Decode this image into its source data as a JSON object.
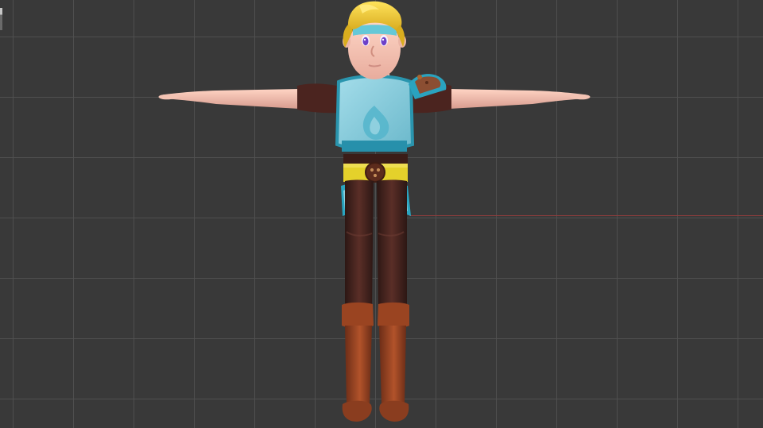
{
  "viewport": {
    "background_color": "#393939",
    "grid_color": "#505050",
    "axis_x_color": "#8e3d3d"
  },
  "character": {
    "label": "",
    "pose": "t-pose",
    "colors": {
      "skin": "#f2c7b7",
      "skin_shadow": "#d99b8b",
      "hair": "#f0cf32",
      "hair_shadow": "#c59b14",
      "headband": "#64c8d6",
      "eye": "#6c41c9",
      "armor": "#8fd0df",
      "armor_dark": "#2a95ae",
      "shirt_brown": "#4a241f",
      "trousers_brown": "#321a16",
      "belt_yellow": "#e4d12b",
      "boots": "#8a3d1f",
      "boots_light": "#b55a30"
    }
  }
}
